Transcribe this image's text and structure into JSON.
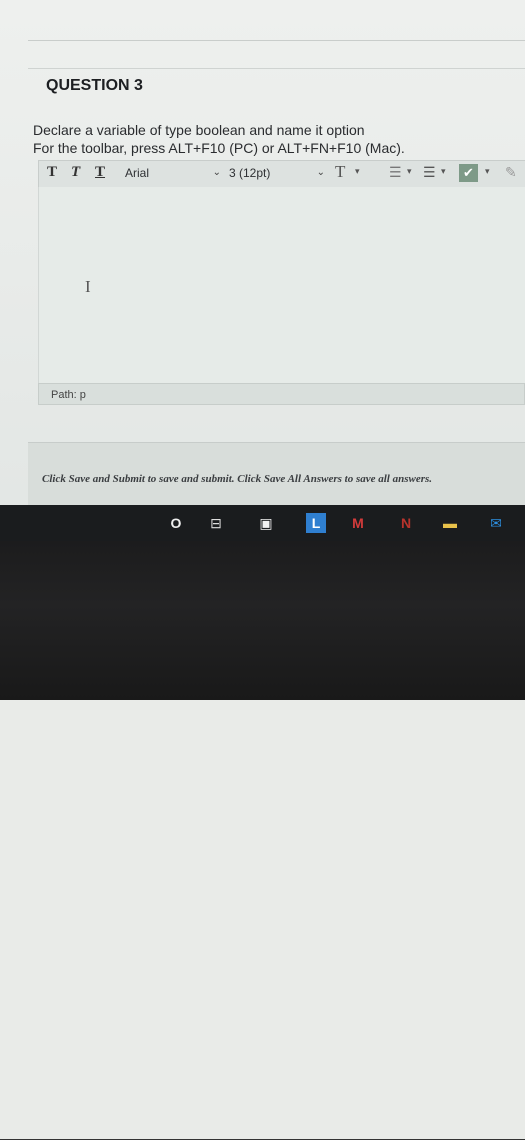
{
  "question": {
    "title": "QUESTION 3",
    "line1": "Declare a variable of type boolean and name it option",
    "line2": "For the toolbar, press ALT+F10 (PC) or ALT+FN+F10 (Mac)."
  },
  "toolbar": {
    "bold_glyph": "T",
    "italic_glyph": "T",
    "underline_glyph": "T",
    "font_family": "Arial",
    "font_size": "3 (12pt)",
    "text_color_glyph": "T",
    "bullet_list_glyph": "☰",
    "numbered_list_glyph": "☰",
    "spellcheck_glyph": "✔",
    "dropdown_glyph": "▾",
    "select_chevron": "⌄",
    "pen_glyph": "✎"
  },
  "editor": {
    "cursor_glyph": "I",
    "path_label": "Path: p"
  },
  "footer": {
    "submit_text": "Click Save and Submit to save and submit. Click Save All Answers to save all answers."
  },
  "taskbar": {
    "search_glyph": "O",
    "task_view_glyph": "⊟",
    "store_glyph": "▣",
    "app_l_label": "L",
    "mail_glyph": "M",
    "app_n_label": "N",
    "files_glyph": "▬",
    "mail2_glyph": "✉"
  },
  "colors": {
    "taskbar_bg": "#1a1c1e",
    "app_l_blue": "#2f7fd0",
    "mail_red": "#d23b3b",
    "app_n_red": "#b8332c",
    "files_yellow": "#e8c14a",
    "mail2_blue": "#2d8fe0"
  }
}
